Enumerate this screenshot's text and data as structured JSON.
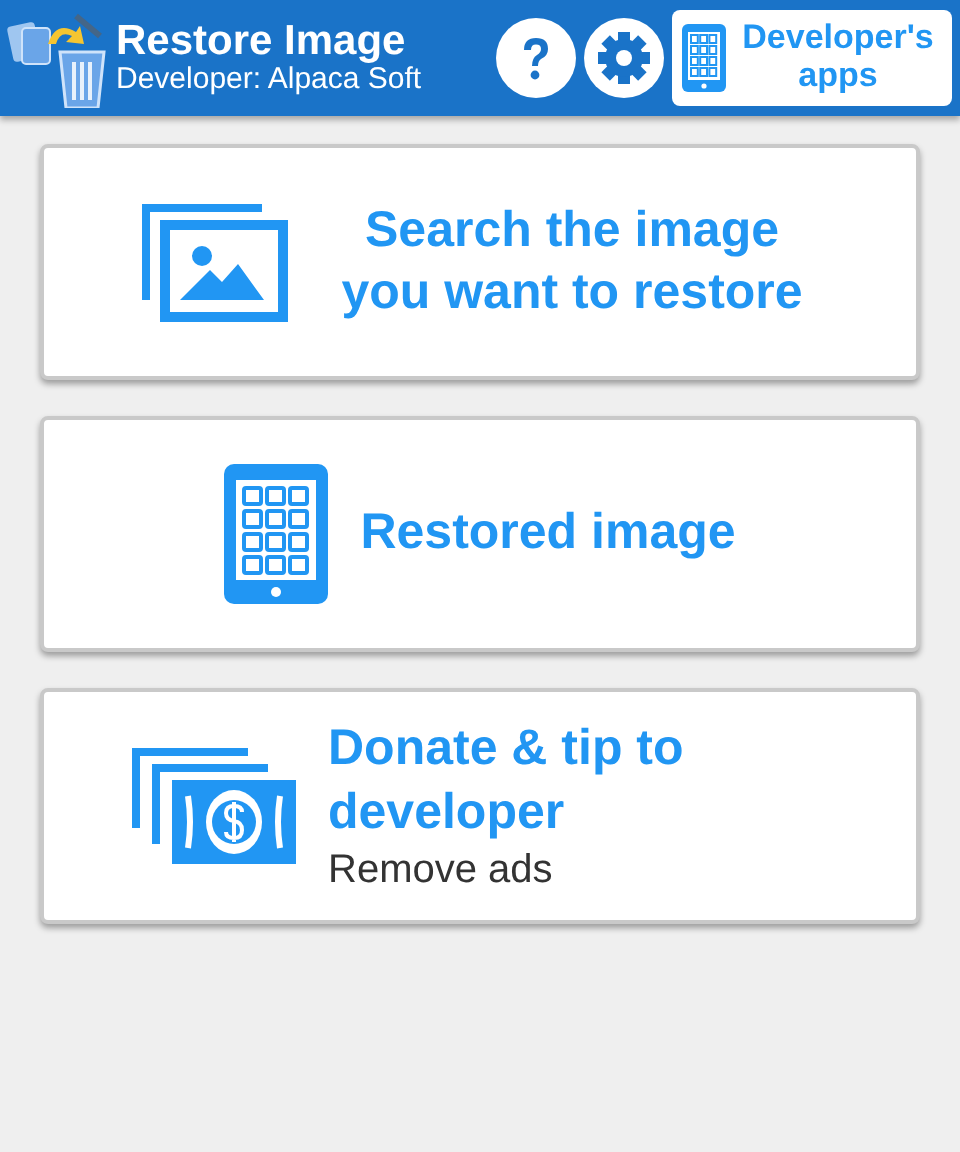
{
  "header": {
    "title": "Restore Image",
    "subtitle": "Developer: Alpaca Soft",
    "apps_button": "Developer's apps"
  },
  "cards": [
    {
      "kind": "search",
      "title": "Search the image you want to restore"
    },
    {
      "kind": "restored",
      "title": "Restored image"
    },
    {
      "kind": "donate",
      "title": "Donate & tip to developer",
      "subtitle": "Remove ads"
    }
  ]
}
